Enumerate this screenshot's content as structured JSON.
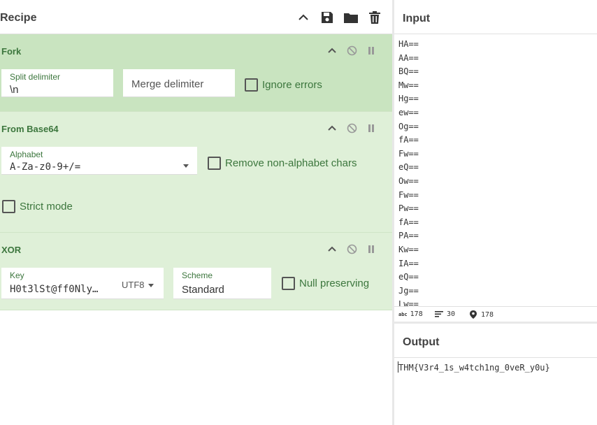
{
  "recipe": {
    "title": "Recipe",
    "icons": [
      "chevron-up-icon",
      "save-icon",
      "folder-icon",
      "trash-icon"
    ]
  },
  "operations": {
    "fork": {
      "title": "Fork",
      "split_label": "Split delimiter",
      "split_value": "\\n",
      "merge_placeholder": "Merge delimiter",
      "ignore_errors": "Ignore errors"
    },
    "from_base64": {
      "title": "From Base64",
      "alphabet_label": "Alphabet",
      "alphabet_value": "A-Za-z0-9+/=",
      "remove_nonalpha": "Remove non-alphabet chars",
      "strict_mode": "Strict mode"
    },
    "xor": {
      "title": "XOR",
      "key_label": "Key",
      "key_value": "H0t3lSt@ff0Nly…",
      "key_encoding": "UTF8",
      "scheme_label": "Scheme",
      "scheme_value": "Standard",
      "null_preserving": "Null preserving"
    }
  },
  "input": {
    "title": "Input",
    "lines": [
      "HA==",
      "AA==",
      "BQ==",
      "Mw==",
      "Hg==",
      "ew==",
      "Og==",
      "fA==",
      "Fw==",
      "eQ==",
      "Ow==",
      "Fw==",
      "Pw==",
      "fA==",
      "PA==",
      "Kw==",
      "IA==",
      "eQ==",
      "Jg==",
      "Lw=="
    ],
    "stats": {
      "chars": "178",
      "lines": "30",
      "position": "178",
      "chars_icon": "abc-icon"
    }
  },
  "output": {
    "title": "Output",
    "text": "THM{V3r4_1s_w4tch1ng_0veR_y0u}"
  },
  "colors": {
    "op_active_bg": "#c9e4c0",
    "op_bg": "#dff0d8",
    "op_text": "#3c763d"
  }
}
